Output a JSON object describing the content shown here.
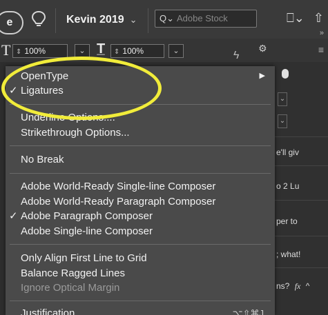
{
  "app_bar": {
    "account_label": "e",
    "workspace": "Kevin 2019",
    "workspace_chevron": "⌄",
    "search": {
      "icon": "Q⌄",
      "placeholder": "Adobe Stock"
    },
    "right_icons": [
      "⎕⌄",
      "share-icon"
    ],
    "collapse_label": "»"
  },
  "char_controls": {
    "size_value": "100%",
    "scale_value": "100%"
  },
  "menu": {
    "items": [
      {
        "label": "OpenType",
        "checked": false,
        "submenu": true
      },
      {
        "label": "Ligatures",
        "checked": true
      },
      {
        "label": "Underline Options....",
        "checked": false
      },
      {
        "label": "Strikethrough Options...",
        "checked": false
      },
      {
        "label": "No Break",
        "checked": false
      },
      {
        "label": "Adobe World-Ready Single-line Composer",
        "checked": false
      },
      {
        "label": "Adobe World-Ready Paragraph Composer",
        "checked": false
      },
      {
        "label": "Adobe Paragraph Composer",
        "checked": true
      },
      {
        "label": "Adobe Single-line Composer",
        "checked": false
      },
      {
        "label": "Only Align First Line to Grid",
        "checked": false
      },
      {
        "label": "Balance Ragged Lines",
        "checked": false
      },
      {
        "label": "Ignore Optical Margin",
        "checked": false,
        "disabled": true
      },
      {
        "label": "Justification...",
        "checked": false,
        "shortcut": "⌥⇧⌘J"
      }
    ]
  },
  "right_panel": {
    "snippets": [
      "e'll giv",
      "o 2 Lu",
      "per to",
      "; what!",
      "ns?"
    ],
    "fx": "fx",
    "up_chevron": "^"
  },
  "colors": {
    "highlight": "#f1ec3a",
    "menu_bg": "#4a4a4a"
  }
}
